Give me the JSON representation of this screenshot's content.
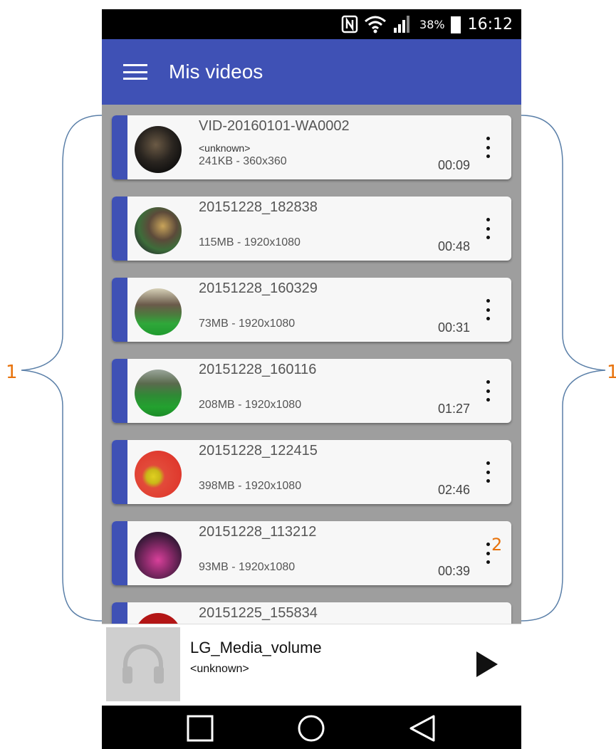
{
  "status_bar": {
    "battery_percent": "38%",
    "time": "16:12",
    "icons": [
      "nfc-icon",
      "wifi-icon",
      "signal-icon",
      "battery-icon"
    ]
  },
  "app_bar": {
    "title": "Mis videos",
    "menu_icon": "hamburger-menu-icon"
  },
  "videos": [
    {
      "title": "VID-20160101-WA0002",
      "artist": "<unknown>",
      "meta": "241KB - 360x360",
      "duration": "00:09"
    },
    {
      "title": "20151228_182838",
      "artist": "",
      "meta": "115MB - 1920x1080",
      "duration": "00:48"
    },
    {
      "title": "20151228_160329",
      "artist": "",
      "meta": "73MB - 1920x1080",
      "duration": "00:31"
    },
    {
      "title": "20151228_160116",
      "artist": "",
      "meta": "208MB - 1920x1080",
      "duration": "01:27"
    },
    {
      "title": "20151228_122415",
      "artist": "",
      "meta": "398MB - 1920x1080",
      "duration": "02:46"
    },
    {
      "title": "20151228_113212",
      "artist": "",
      "meta": "93MB - 1920x1080",
      "duration": "00:39"
    },
    {
      "title": "20151225_155834",
      "artist": "",
      "meta": "",
      "duration": ""
    }
  ],
  "player": {
    "title": "LG_Media_volume",
    "artist": "<unknown>",
    "art_icon": "headphones-icon",
    "play_icon": "play-icon"
  },
  "nav_bar": {
    "icons": [
      "recents-square-icon",
      "home-circle-icon",
      "back-triangle-icon"
    ]
  },
  "annotations": {
    "left_label": "1",
    "right_label": "1",
    "more_label": "2"
  },
  "colors": {
    "primary": "#3f51b5",
    "annotation": "#e8730c",
    "brace": "#5a7fa8"
  }
}
